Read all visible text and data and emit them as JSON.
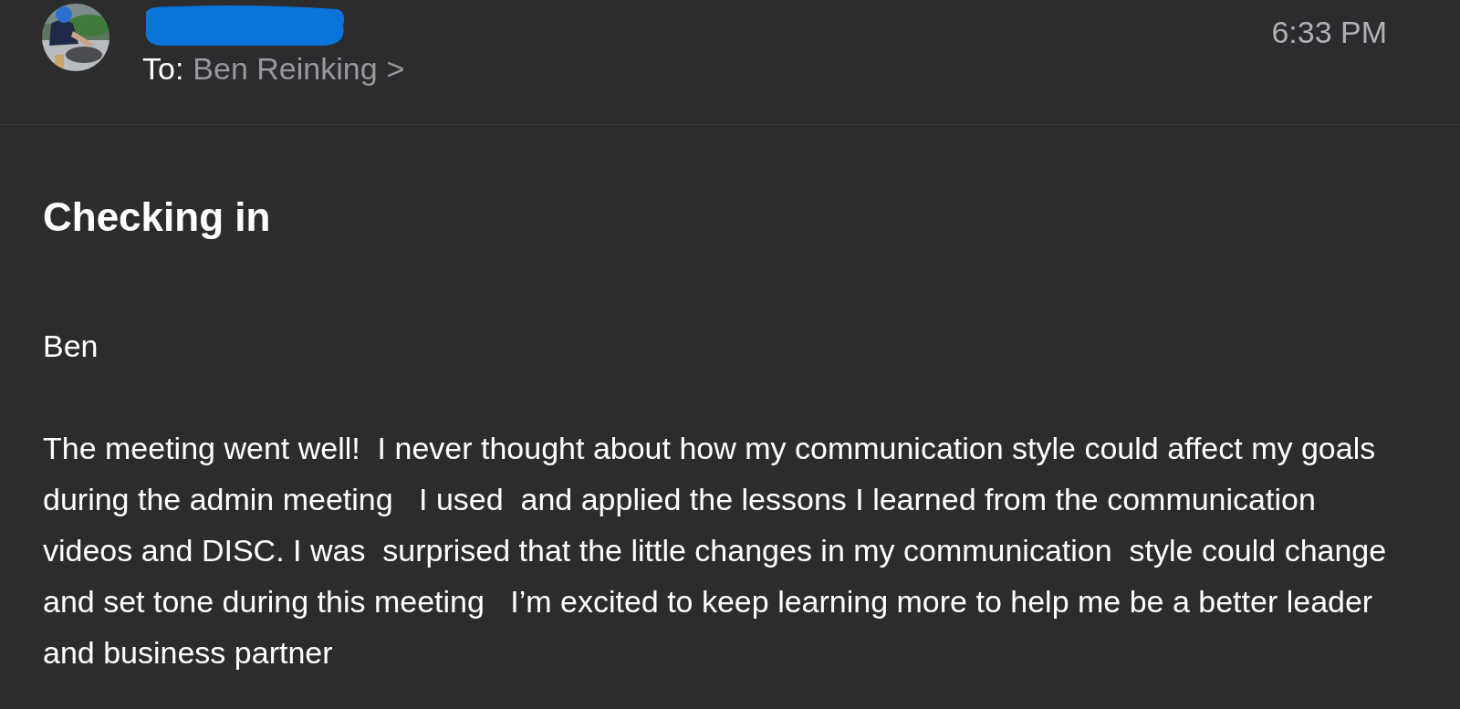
{
  "header": {
    "to_label": "To:",
    "recipient": "Ben Reinking",
    "chevron": ">",
    "time": "6:33 PM"
  },
  "subject": "Checking in",
  "body": [
    "Ben",
    "The meeting went well!  I never thought about how my communication style could affect my goals during the admin meeting   I used  and applied the lessons I learned from the communication videos and DISC. I was  surprised that the little changes in my communication  style could change and set tone during this meeting   I’m excited to keep learning more to help me be a better leader and business partner"
  ]
}
